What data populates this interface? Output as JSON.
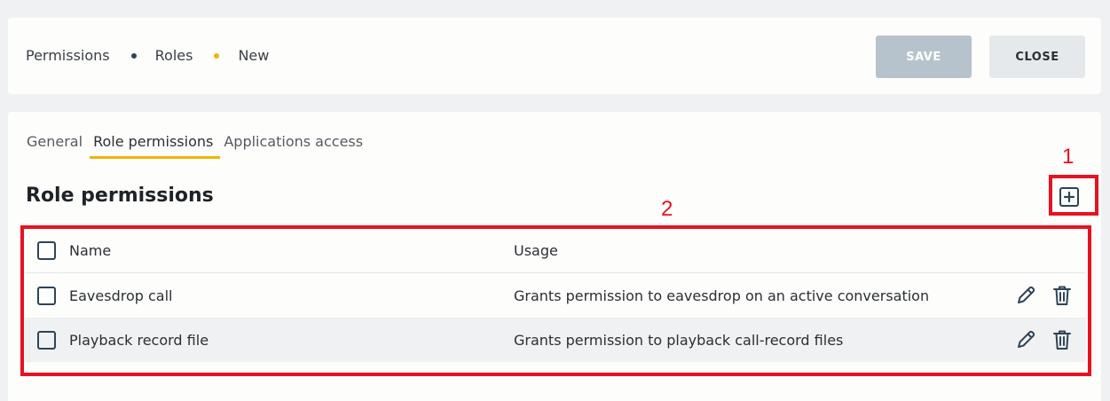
{
  "breadcrumb": {
    "items": [
      {
        "label": "Permissions",
        "dot_color": "#2e4457"
      },
      {
        "label": "Roles",
        "dot_color": "#f0b400"
      },
      {
        "label": "New"
      }
    ]
  },
  "toolbar": {
    "save_label": "SAVE",
    "close_label": "CLOSE"
  },
  "tabs": [
    {
      "label": "General",
      "active": false
    },
    {
      "label": "Role permissions",
      "active": true
    },
    {
      "label": "Applications access",
      "active": false
    }
  ],
  "section": {
    "title": "Role permissions"
  },
  "table": {
    "columns": [
      "Name",
      "Usage"
    ],
    "rows": [
      {
        "name": "Eavesdrop call",
        "usage": "Grants permission to eavesdrop on an active conversation"
      },
      {
        "name": "Playback record file",
        "usage": "Grants permission to playback call-record files"
      }
    ]
  },
  "annotations": [
    {
      "label": "1"
    },
    {
      "label": "2"
    }
  ],
  "colors": {
    "accent": "#f0b400",
    "icon": "#2e4457",
    "annotation": "#e8121f",
    "save_disabled": "#b7c3cc"
  },
  "icons": [
    "add-square-icon",
    "checkbox-icon",
    "pencil-icon",
    "trash-icon"
  ]
}
